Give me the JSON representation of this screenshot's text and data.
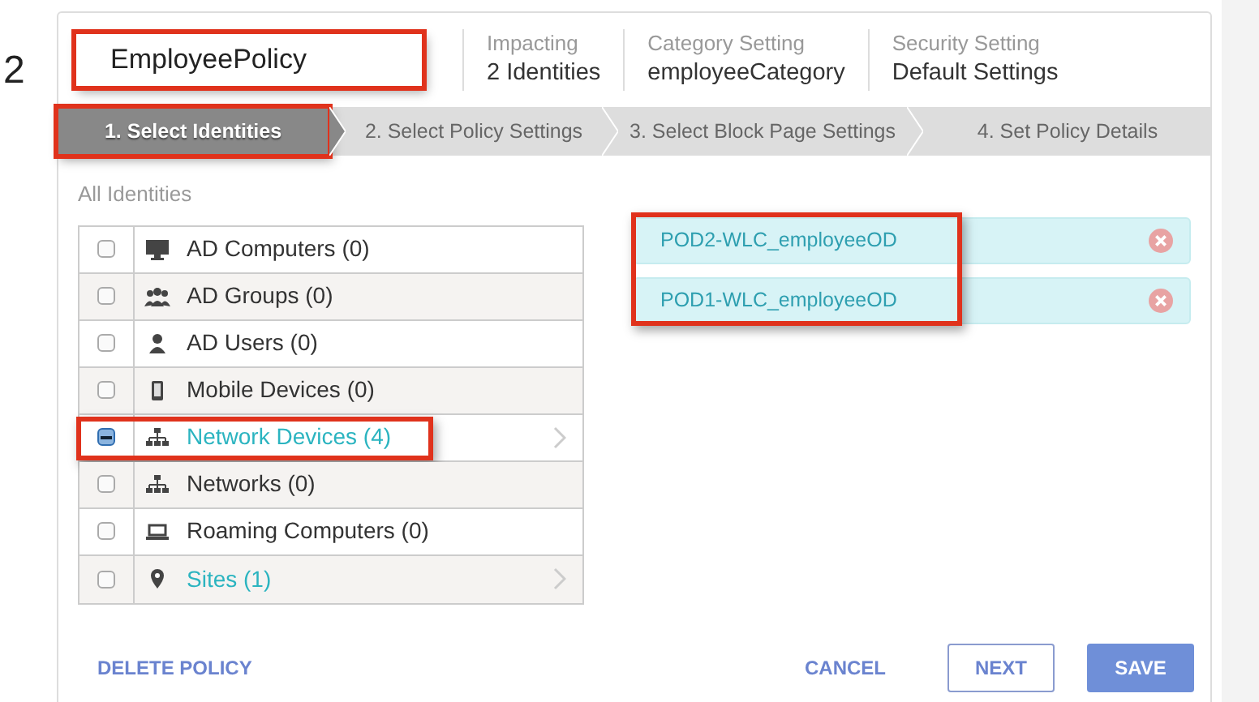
{
  "row_number": "2",
  "policy_name": {
    "value": "EmployeePolicy",
    "highlighted": true
  },
  "summary": [
    {
      "label": "Impacting",
      "value": "2 Identities"
    },
    {
      "label": "Category Setting",
      "value": "employeeCategory"
    },
    {
      "label": "Security Setting",
      "value": "Default Settings"
    }
  ],
  "steps": [
    {
      "label": "1. Select Identities",
      "selected": true,
      "highlighted": true
    },
    {
      "label": "2. Select Policy Settings",
      "selected": false,
      "highlighted": false
    },
    {
      "label": "3. Select Block Page Settings",
      "selected": false,
      "highlighted": false
    },
    {
      "label": "4. Set Policy Details",
      "selected": false,
      "highlighted": false
    }
  ],
  "identities": {
    "title": "All Identities",
    "items": [
      {
        "label": "AD Computers (0)",
        "checked": false,
        "indeterminate": false,
        "expandable": false,
        "highlighted": false
      },
      {
        "label": "AD Groups (0)",
        "checked": false,
        "indeterminate": false,
        "expandable": false,
        "highlighted": false
      },
      {
        "label": "AD Users (0)",
        "checked": false,
        "indeterminate": false,
        "expandable": false,
        "highlighted": false
      },
      {
        "label": "Mobile Devices (0)",
        "checked": false,
        "indeterminate": false,
        "expandable": false,
        "highlighted": false
      },
      {
        "label": "Network Devices (4)",
        "checked": true,
        "indeterminate": true,
        "expandable": true,
        "highlighted": true
      },
      {
        "label": "Networks (0)",
        "checked": false,
        "indeterminate": false,
        "expandable": false,
        "highlighted": false
      },
      {
        "label": "Roaming Computers (0)",
        "checked": false,
        "indeterminate": false,
        "expandable": false,
        "highlighted": false
      },
      {
        "label": "Sites (1)",
        "checked": false,
        "indeterminate": false,
        "expandable": true,
        "highlighted": false
      }
    ]
  },
  "selected_identities": {
    "highlighted": true,
    "items": [
      {
        "label": "POD2-WLC_employeeOD"
      },
      {
        "label": "POD1-WLC_employeeOD"
      }
    ]
  },
  "footer": {
    "delete": "DELETE POLICY",
    "cancel": "CANCEL",
    "next": "NEXT",
    "save": "SAVE"
  }
}
